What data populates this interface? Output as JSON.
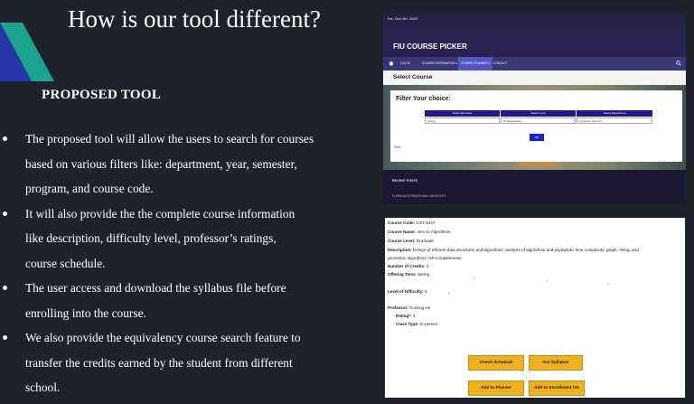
{
  "slide": {
    "title": "How is our tool different?",
    "section_heading": "PROPOSED TOOL",
    "bullets": [
      {
        "lines": [
          "The proposed tool will allow the users to search for courses",
          "based on various  filters like: department, year, semester,",
          "program, and course code."
        ]
      },
      {
        "lines": [
          " It will also  provide the  the complete course information",
          "like  description, difficulty level, professor’s ratings,",
          "course schedule."
        ]
      },
      {
        "lines": [
          "The user access and download the syllabus file before",
          "enrolling into the course."
        ]
      },
      {
        "lines": [
          "We  also provide the equivalency course search feature to",
          "transfer the credits earned by the student from different",
          "school."
        ]
      }
    ],
    "colors": {
      "background": "#1f222b",
      "accent_teal": "#1aa38f",
      "accent_blue": "#2436a8"
    }
  },
  "course_picker": {
    "date": "Tue, Dec 8th, 2020",
    "brand": "FIU COURSE PICKER",
    "nav": [
      "LOG IN",
      "COURSE INFORMATION ▾",
      "COURSE PLANNER ▾",
      "CONTACT"
    ],
    "active_nav": "COURSE PLANNER ▾",
    "icons": {
      "home": "home-icon",
      "search": "search-icon"
    },
    "select_heading": "Select Course",
    "filter_title": "Filter Your choice:",
    "filter_headers": [
      "Select Semester",
      "Select Level",
      "Select Department"
    ],
    "filter_values": [
      "Spring",
      "Undergraduate",
      "Computer Science"
    ],
    "ok_label": "OK",
    "link": "Edit",
    "recent_posts": "RECENT POSTS",
    "footer_text": "FLORIDA INTERNATIONAL UNIVERSITY"
  },
  "course_detail": {
    "code_label": "Course Code:",
    "code": "COT-5407",
    "name_label": "Course Name:",
    "name": "Intro to Algorithms",
    "level_label": "Course Level:",
    "level": "Graduate",
    "description_label": "Description:",
    "description_1": "Design of efficient data structures and algorithms; analysis of algorithms and asymptotic time complexity; graph, string, and",
    "description_2": "geometric algorithms; NP-completeness.",
    "credits_label": "Number of Credits:",
    "credits": "3",
    "term_label": "Offering Term:",
    "term": "Spring",
    "difficulty_label": "Level of Difficulty:",
    "difficulty": "5",
    "professor_label": "Professor:",
    "professor": "Xudong He",
    "rating_label": "Rating*:",
    "rating": "4",
    "class_type_label": "Class Type:",
    "class_type": "In-person",
    "buttons": {
      "check_schedule": "Check Schedule",
      "get_syllabus": "Get Syllabus",
      "add_to_planner": "Add to Planner",
      "add_to_enrollment": "Add to Enrollment list"
    },
    "button_color": "#f0b11e"
  }
}
